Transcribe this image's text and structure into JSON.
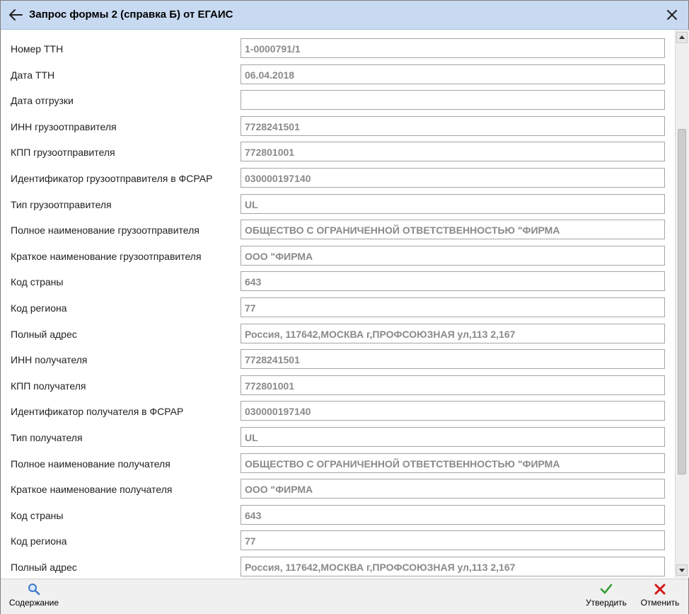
{
  "window": {
    "title": "Запрос формы 2 (справка Б) от ЕГАИС",
    "back_icon": "arrow-left-icon",
    "close_icon": "close-icon"
  },
  "form": {
    "fields": [
      {
        "label": "Номер ТТН",
        "value": "1-0000791/1"
      },
      {
        "label": "Дата ТТН",
        "value": "06.04.2018"
      },
      {
        "label": "Дата отгрузки",
        "value": ""
      },
      {
        "label": "ИНН грузоотправителя",
        "value": "7728241501"
      },
      {
        "label": "КПП грузоотправителя",
        "value": "772801001"
      },
      {
        "label": "Идентификатор грузоотправителя в ФСРАР",
        "value": "030000197140"
      },
      {
        "label": "Тип грузоотправителя",
        "value": "UL"
      },
      {
        "label": "Полное наименование грузоотправителя",
        "value": "ОБЩЕСТВО С ОГРАНИЧЕННОЙ ОТВЕТСТВЕННОСТЬЮ   \"ФИРМА"
      },
      {
        "label": "Краткое наименование грузоотправителя",
        "value": "ООО \"ФИРМА"
      },
      {
        "label": "Код страны",
        "value": "643"
      },
      {
        "label": "Код региона",
        "value": "77"
      },
      {
        "label": "Полный адрес",
        "value": "Россия, 117642,МОСКВА г,ПРОФСОЮЗНАЯ ул,113 2,167"
      },
      {
        "label": "ИНН получателя",
        "value": "7728241501"
      },
      {
        "label": "КПП получателя",
        "value": "772801001"
      },
      {
        "label": "Идентификатор получателя в ФСРАР",
        "value": "030000197140"
      },
      {
        "label": "Тип получателя",
        "value": "UL"
      },
      {
        "label": "Полное наименование получателя",
        "value": "ОБЩЕСТВО С ОГРАНИЧЕННОЙ ОТВЕТСТВЕННОСТЬЮ   \"ФИРМА"
      },
      {
        "label": "Краткое наименование получателя",
        "value": "ООО \"ФИРМА"
      },
      {
        "label": "Код страны",
        "value": "643"
      },
      {
        "label": "Код региона",
        "value": "77"
      },
      {
        "label": "Полный адрес",
        "value": "Россия, 117642,МОСКВА г,ПРОФСОЮЗНАЯ ул,113 2,167"
      }
    ]
  },
  "footer": {
    "contents_label": "Содержание",
    "contents_icon": "magnifier-icon",
    "approve_label": "Утвердить",
    "approve_icon": "checkmark-icon",
    "cancel_label": "Отменить",
    "cancel_icon": "cross-icon"
  },
  "colors": {
    "titlebar": "#c8daf2",
    "approve_icon": "#2e9a2e",
    "cancel_icon": "#d01818",
    "field_text": "#8a8a8a"
  }
}
